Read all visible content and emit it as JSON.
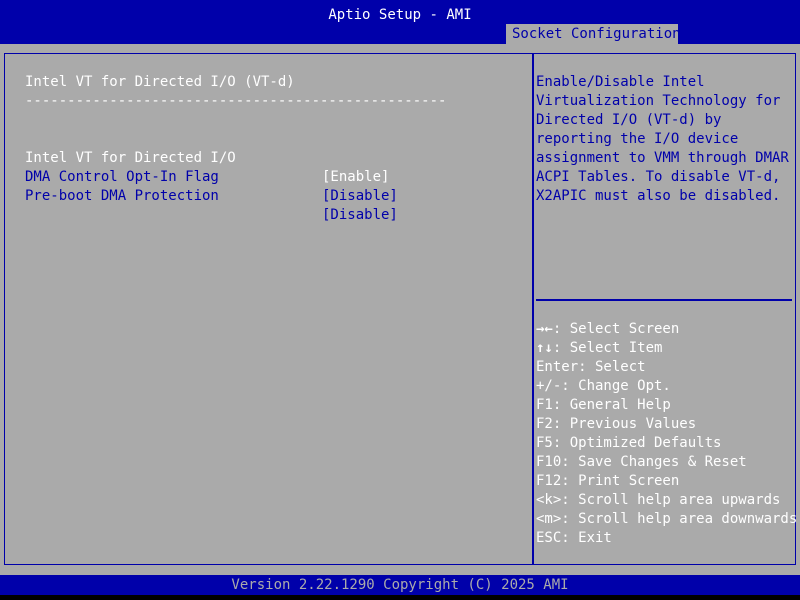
{
  "header": {
    "app_title": "Aptio Setup - AMI",
    "active_tab": "Socket Configuration"
  },
  "main": {
    "section_title": "Intel VT for Directed I/O (VT-d)",
    "separator": "--------------------------------------------------",
    "settings": [
      {
        "label": "Intel VT for Directed I/O",
        "value": "[Enable]",
        "selected": true
      },
      {
        "label": "DMA Control Opt-In Flag",
        "value": "[Disable]",
        "selected": false
      },
      {
        "label": "Pre-boot DMA Protection",
        "value": "[Disable]",
        "selected": false
      }
    ]
  },
  "help": {
    "lines": [
      "Enable/Disable Intel",
      "Virtualization Technology for",
      "Directed I/O (VT-d) by",
      "reporting the I/O device",
      "assignment to VMM through DMAR",
      "ACPI Tables. To disable VT-d,",
      "X2APIC must also be disabled."
    ]
  },
  "keys": [
    {
      "key": "→←",
      "desc": ": Select Screen"
    },
    {
      "key": "↑↓",
      "desc": ": Select Item"
    },
    {
      "key": "",
      "desc": "Enter: Select"
    },
    {
      "key": "",
      "desc": "+/-: Change Opt."
    },
    {
      "key": "",
      "desc": "F1: General Help"
    },
    {
      "key": "",
      "desc": "F2: Previous Values"
    },
    {
      "key": "",
      "desc": "F5: Optimized Defaults"
    },
    {
      "key": "",
      "desc": "F10: Save Changes & Reset"
    },
    {
      "key": "",
      "desc": "F12: Print Screen"
    },
    {
      "key": "",
      "desc": "<k>: Scroll help area upwards"
    },
    {
      "key": "",
      "desc": "<m>: Scroll help area downwards"
    },
    {
      "key": "",
      "desc": "ESC: Exit"
    }
  ],
  "footer": {
    "version": "Version 2.22.1290 Copyright (C) 2025 AMI"
  },
  "colors": {
    "bios_blue": "#0000aa",
    "panel_gray": "#aaaaaa",
    "highlight_white": "#ffffff"
  }
}
